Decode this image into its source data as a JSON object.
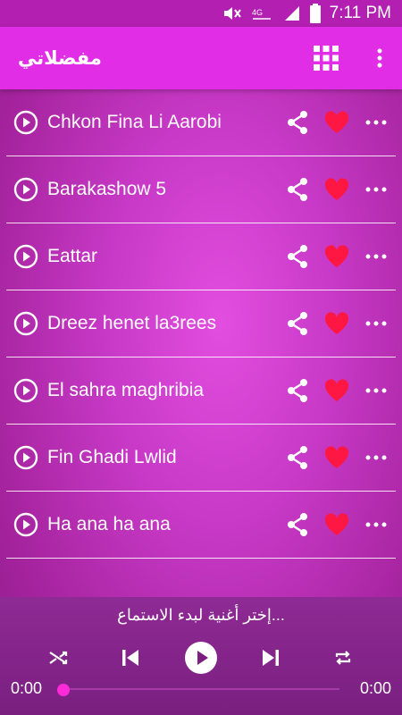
{
  "status_bar": {
    "time": "7:11 PM"
  },
  "app_bar": {
    "title": "مفضلاتي",
    "grid_icon": "grid-icon",
    "menu_icon": "more-vert-icon"
  },
  "songs": [
    {
      "title": "Chkon Fina Li Aarobi"
    },
    {
      "title": "Barakashow 5"
    },
    {
      "title": "Eattar"
    },
    {
      "title": "Dreez henet la3rees"
    },
    {
      "title": "El sahra maghribia"
    },
    {
      "title": "Fin Ghadi Lwlid"
    },
    {
      "title": "Ha ana ha ana"
    }
  ],
  "player": {
    "hint": "إختر أغنية لبدء الاستماع...",
    "current_time": "0:00",
    "duration": "0:00",
    "progress": 0
  },
  "colors": {
    "appbar": "#e12ee6",
    "heart": "#ff1744",
    "seek_thumb": "#ff2bd8"
  }
}
